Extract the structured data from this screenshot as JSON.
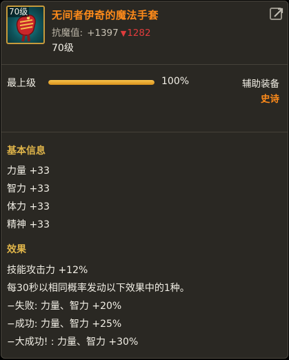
{
  "item": {
    "level_badge": "70级",
    "name": "无间者伊奇的魔法手套",
    "resist_label": "抗魔值:",
    "resist_plus": "+1397",
    "resist_compare": "1282",
    "level_text": "70级"
  },
  "grade": {
    "label": "最上级",
    "progress": 1.0,
    "percent_text": "100%"
  },
  "slot_type": "辅助装备",
  "rarity": "史诗",
  "basic_info": {
    "title": "基本信息",
    "stats": [
      "力量 +33",
      "智力 +33",
      "体力 +33",
      "精神 +33"
    ]
  },
  "effects": {
    "title": "效果",
    "lines": [
      "技能攻击力 +12%",
      "每30秒以相同概率发动以下效果中的1种。",
      "−失败: 力量、智力 +20%",
      "−成功: 力量、智力 +25%",
      "−大成功! : 力量、智力 +30%"
    ]
  },
  "colors": {
    "item_name": "#ff8b1a",
    "section_title": "#e0b54a",
    "decrease": "#e03c3c",
    "bar_fill": "#f0b53a"
  },
  "icons": {
    "item": "glove-icon",
    "lock": "lock-icon",
    "down_arrow": "down-triangle-icon"
  }
}
